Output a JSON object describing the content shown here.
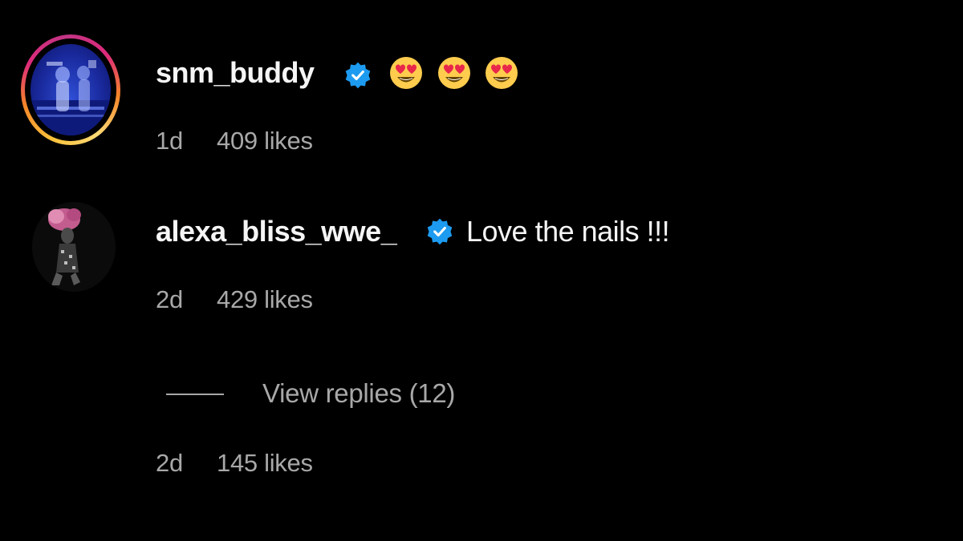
{
  "colors": {
    "background": "#000000",
    "text_primary": "#f5f5f5",
    "text_secondary": "#a8a8a8",
    "verified_blue": "#1d9bf0",
    "story_ring": "#dd2a7b"
  },
  "comments": [
    {
      "username": "snm_buddy",
      "verified": true,
      "verified_icon": "verified-badge-icon",
      "text": "",
      "emojis": [
        "heart-eyes-emoji",
        "heart-eyes-emoji",
        "heart-eyes-emoji"
      ],
      "time": "1d",
      "likes": "409 likes",
      "has_story_ring": true
    },
    {
      "username": "alexa_bliss_wwe_",
      "verified": true,
      "verified_icon": "verified-badge-icon",
      "text": "Love the nails !!!",
      "time": "2d",
      "likes": "429 likes",
      "has_story_ring": false
    }
  ],
  "replies": {
    "view_label": "View replies (12)",
    "time": "2d",
    "likes": "145 likes"
  }
}
